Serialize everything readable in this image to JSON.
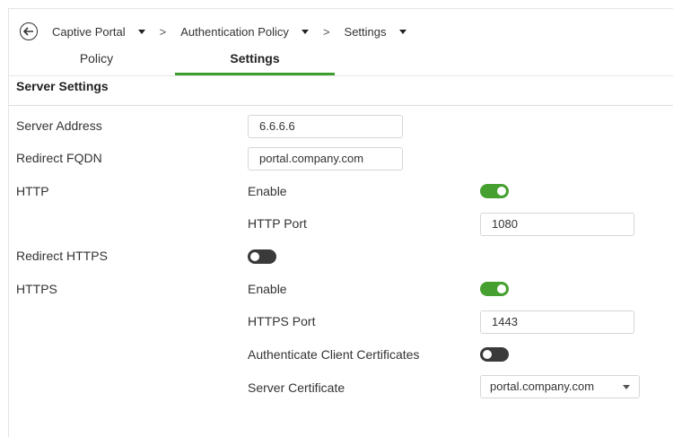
{
  "breadcrumb": {
    "items": [
      "Captive Portal",
      "Authentication Policy",
      "Settings"
    ],
    "separator": ">"
  },
  "tabs": [
    {
      "label": "Policy",
      "active": false
    },
    {
      "label": "Settings",
      "active": true
    }
  ],
  "section": {
    "title": "Server Settings"
  },
  "fields": {
    "server_address": {
      "label": "Server Address",
      "value": "6.6.6.6"
    },
    "redirect_fqdn": {
      "label": "Redirect FQDN",
      "value": "portal.company.com"
    },
    "http": {
      "label": "HTTP",
      "enable_label": "Enable",
      "enabled": true,
      "port_label": "HTTP Port",
      "port": "1080"
    },
    "redirect_https": {
      "label": "Redirect HTTPS",
      "enabled": false
    },
    "https": {
      "label": "HTTPS",
      "enable_label": "Enable",
      "enabled": true,
      "port_label": "HTTPS Port",
      "port": "1443",
      "auth_client_certs_label": "Authenticate Client Certificates",
      "auth_client_certs": false,
      "server_cert_label": "Server Certificate",
      "server_cert": "portal.company.com"
    }
  },
  "colors": {
    "accent": "#45a02f",
    "toggle_off": "#3a3a3a",
    "tab_underline": "#3c9e2c"
  },
  "icons": [
    "back-arrow-icon",
    "chevron-down-icon"
  ]
}
